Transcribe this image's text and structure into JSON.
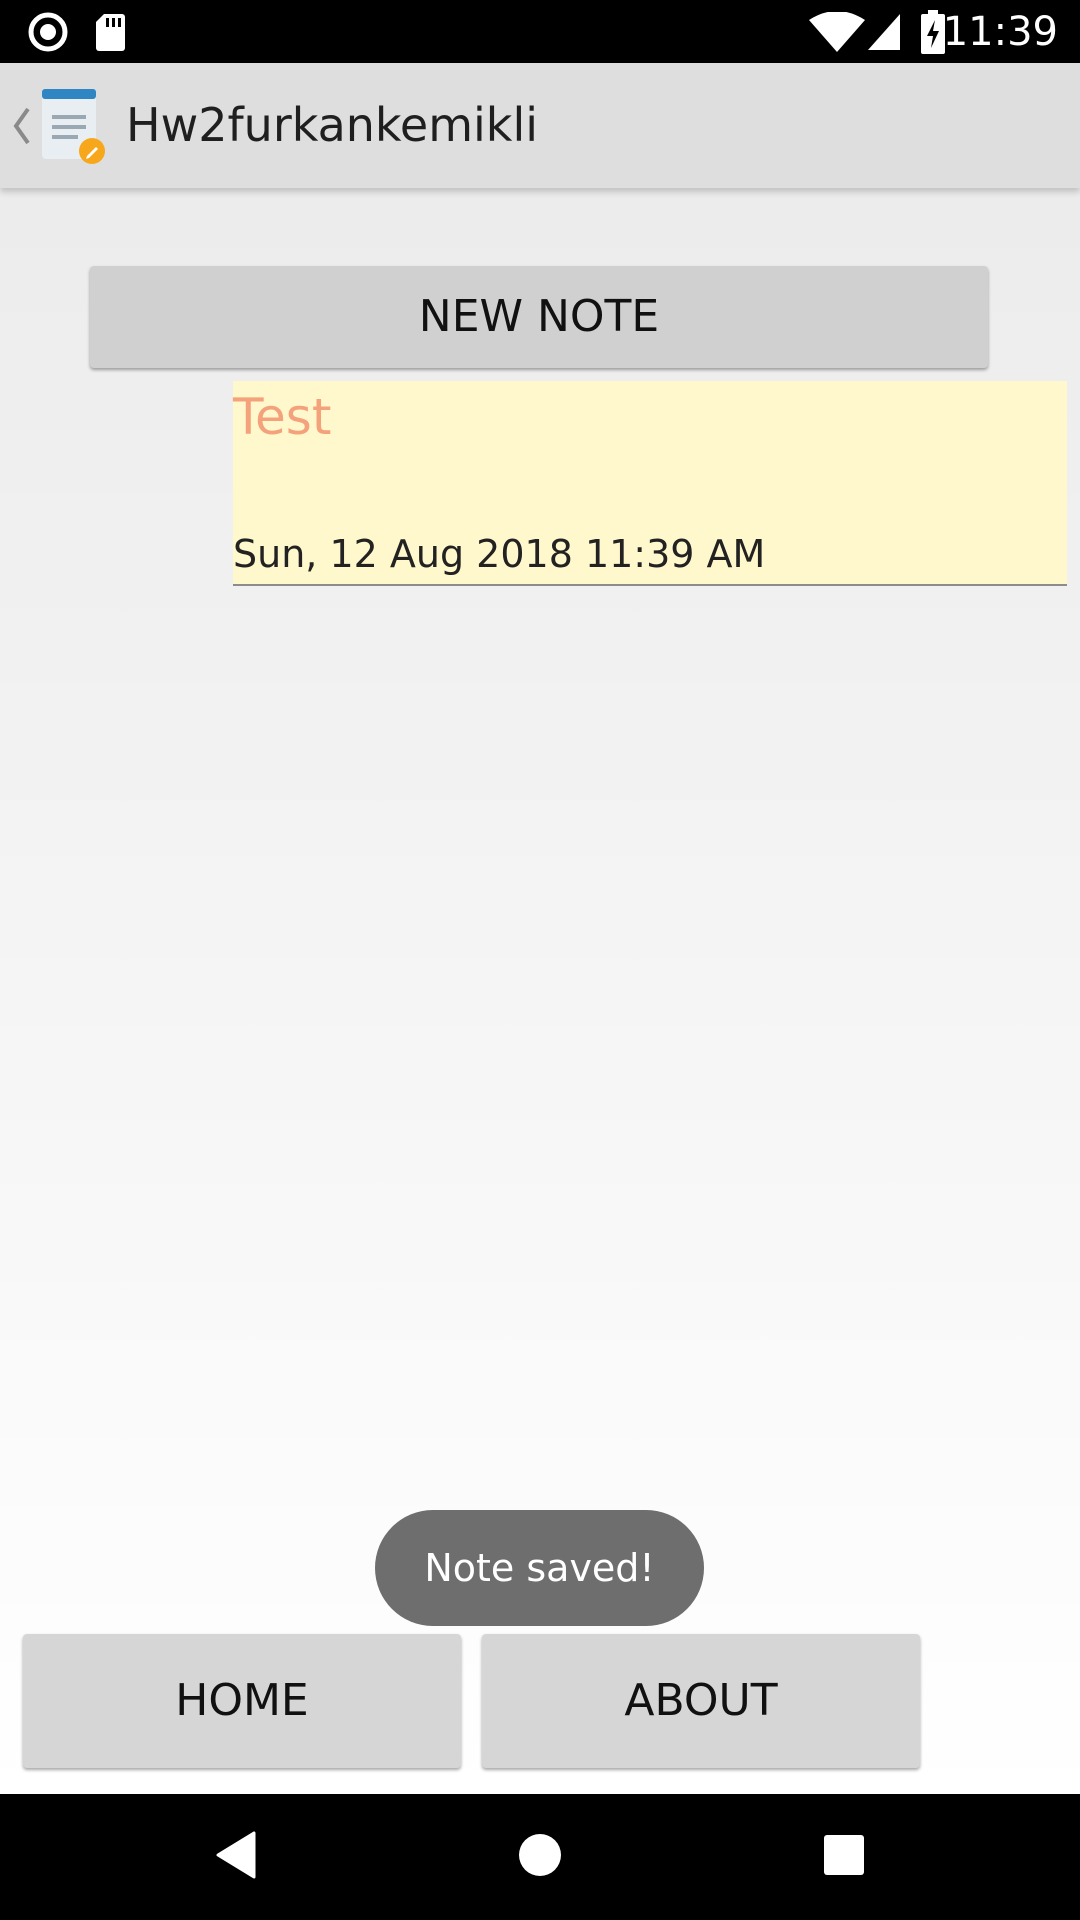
{
  "status_bar": {
    "time": "11:39",
    "icons": [
      "record-icon",
      "sd-card-icon",
      "wifi-icon",
      "signal-icon",
      "battery-charging-icon"
    ]
  },
  "action_bar": {
    "title": "Hw2furkankemikli",
    "icons": [
      "back-chevron-icon",
      "notepad-app-icon"
    ]
  },
  "main": {
    "new_note_label": "NEW NOTE",
    "notes": [
      {
        "title": "Test",
        "date": "Sun, 12 Aug 2018 11:39 AM"
      }
    ],
    "toast": "Note saved!"
  },
  "bottom_buttons": {
    "home_label": "HOME",
    "about_label": "ABOUT"
  },
  "nav_bar": {
    "icons": [
      "back-triangle-icon",
      "home-circle-icon",
      "recents-square-icon"
    ]
  },
  "colors": {
    "action_bar": "#dedede",
    "note_background": "#fff8cc",
    "note_title": "#f4a27c",
    "toast": "#6e6e6e",
    "button": "#d6d6d6"
  }
}
